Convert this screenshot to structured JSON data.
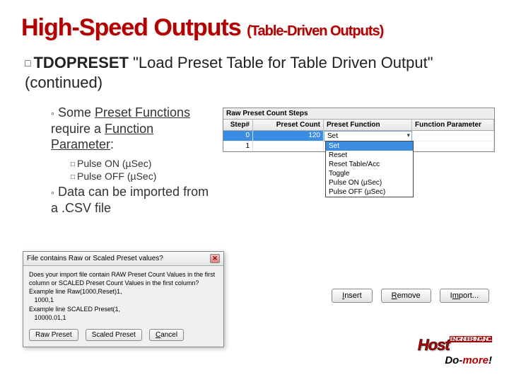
{
  "title_main": "High-Speed Outputs",
  "title_sub": "(Table-Driven Outputs)",
  "main_bullet": {
    "kw": "TDOPRESET",
    "rest": " \"Load Preset Table for Table Driven Output\" (continued)"
  },
  "sub1_pre": "Some ",
  "sub1_u1": "Preset Functions",
  "sub1_mid": " require a ",
  "sub1_u2": "Function Parameter",
  "sub1_post": ":",
  "subsub1": "Pulse ON (µSec)",
  "subsub2": "Pulse OFF (µSec)",
  "sub2": "Data can be imported from a .CSV file",
  "table": {
    "title": "Raw Preset Count Steps",
    "headers": [
      "Step#",
      "Preset Count",
      "Preset Function",
      "Function Parameter"
    ],
    "rows": [
      {
        "step": "0",
        "count": "120",
        "fn": "Set",
        "param": ""
      },
      {
        "step": "1",
        "count": "",
        "fn": "",
        "param": ""
      }
    ],
    "dropdown": [
      "Set",
      "Reset",
      "Reset Table/Acc",
      "Toggle",
      "Pulse ON (µSec)",
      "Pulse OFF (µSec)"
    ]
  },
  "table_buttons": {
    "insert": "Insert",
    "remove": "Remove",
    "import": "Import..."
  },
  "dialog": {
    "title": "File contains Raw or Scaled Preset values?",
    "line1": "Does your import file contain RAW Preset Count Values in the first column or SCALED Preset Count Values in the first column?",
    "line2": "Example line Raw(1000,Reset)1,",
    "line3": "   1000,1",
    "line4": "Example line SCALED Preset(1,",
    "line5": "   10000.01,1",
    "btn_raw": "Raw Preset",
    "btn_scaled": "Scaled Preset",
    "btn_cancel": "Cancel"
  },
  "logo": {
    "top": "Host",
    "eng": "ENGINEERING,INC.",
    "bottom_do": "Do-",
    "bottom_more": "more",
    "bottom_bang": "!"
  }
}
